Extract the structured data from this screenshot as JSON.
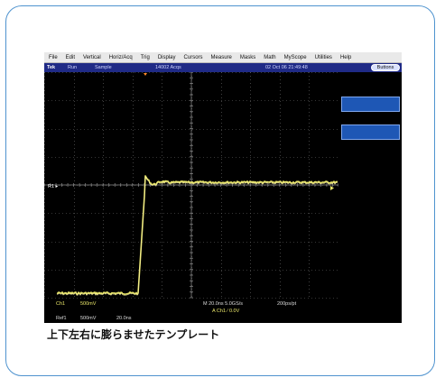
{
  "menu": [
    "File",
    "Edit",
    "Vertical",
    "Horiz/Acq",
    "Trig",
    "Display",
    "Cursors",
    "Measure",
    "Masks",
    "Math",
    "MyScope",
    "Utilities",
    "Help"
  ],
  "status": {
    "brand": "Tek",
    "state": "Run",
    "mode": "Sample",
    "acqs": "14002 Acqs",
    "datetime": "02 Oct 06 21:49:48",
    "buttons_label": "Buttons"
  },
  "scope": {
    "markers": {
      "ch1_level": "1",
      "ref_level": "R1"
    },
    "readouts": {
      "ch1_label": "Ch1",
      "ch1_scale": "500mV",
      "timebase": "M 20.0ns 5.0GS/s",
      "resolution": "200ps/pt",
      "trigger": "A  Ch1  ∕  0.0V",
      "ref_label": "Ref1",
      "ref_scale": "500mV",
      "ref_time": "20.0ns"
    },
    "colors": {
      "trace": "#e9e66a",
      "grid": "#6a6a6a",
      "bg": "#000000",
      "accent": "#4f93cf"
    }
  },
  "caption": "上下左右に膨らませたテンプレート"
}
